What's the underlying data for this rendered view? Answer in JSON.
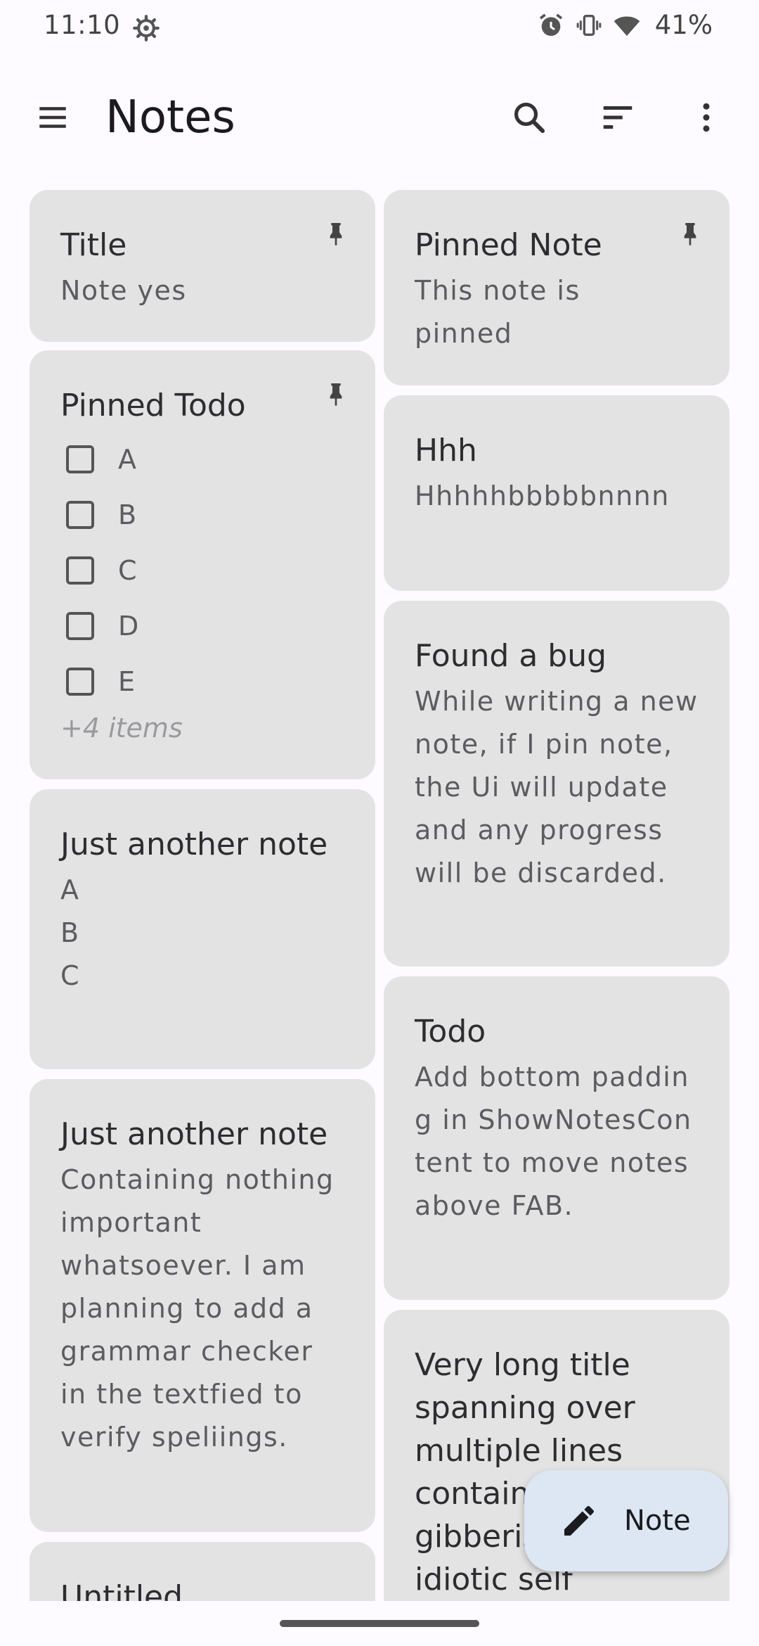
{
  "status_bar": {
    "time": "11:10",
    "battery": "41%",
    "icons": [
      "settings-icon",
      "alarm-icon",
      "vibrate-icon",
      "wifi-icon"
    ]
  },
  "app_bar": {
    "title": "Notes",
    "icons": [
      "menu-icon",
      "search-icon",
      "sort-icon",
      "more-vert-icon"
    ]
  },
  "notes": {
    "title_note": {
      "title": "Title",
      "body": "Note yes",
      "pinned": true
    },
    "pinned_todo": {
      "title": "Pinned Todo",
      "pinned": true,
      "items": [
        "A",
        "B",
        "C",
        "D",
        "E"
      ],
      "more": "+4 items"
    },
    "another_note_1": {
      "title": "Just another note",
      "lines": [
        "A",
        "B",
        "C"
      ]
    },
    "another_note_2": {
      "title": "Just another note",
      "body": "Containing nothing important whatsoever. I am planning to add a grammar checker in the textfied to verify speliings."
    },
    "untitled": {
      "title": "Untitled"
    },
    "pinned_note": {
      "title": "Pinned Note",
      "body": "This note is pinned",
      "pinned": true
    },
    "hhh": {
      "title": "Hhh",
      "body": "Hhhhhbbbbbnnnn"
    },
    "bug": {
      "title": "Found a bug",
      "body": "While writing a new note, if I pin note, the Ui will update and any progress will be discarded."
    },
    "todo": {
      "title": "Todo",
      "body": "Add bottom padding in ShowNotesContent to move notes above FAB."
    },
    "long_title": {
      "title": "Very long title spanning over multiple lines containing gibberish and idiotic self"
    }
  },
  "fab": {
    "label": "Note",
    "icon": "edit-icon"
  },
  "colors": {
    "card": "#e3e3e4",
    "background": "#fdfbff",
    "fab": "#dce7f3"
  }
}
